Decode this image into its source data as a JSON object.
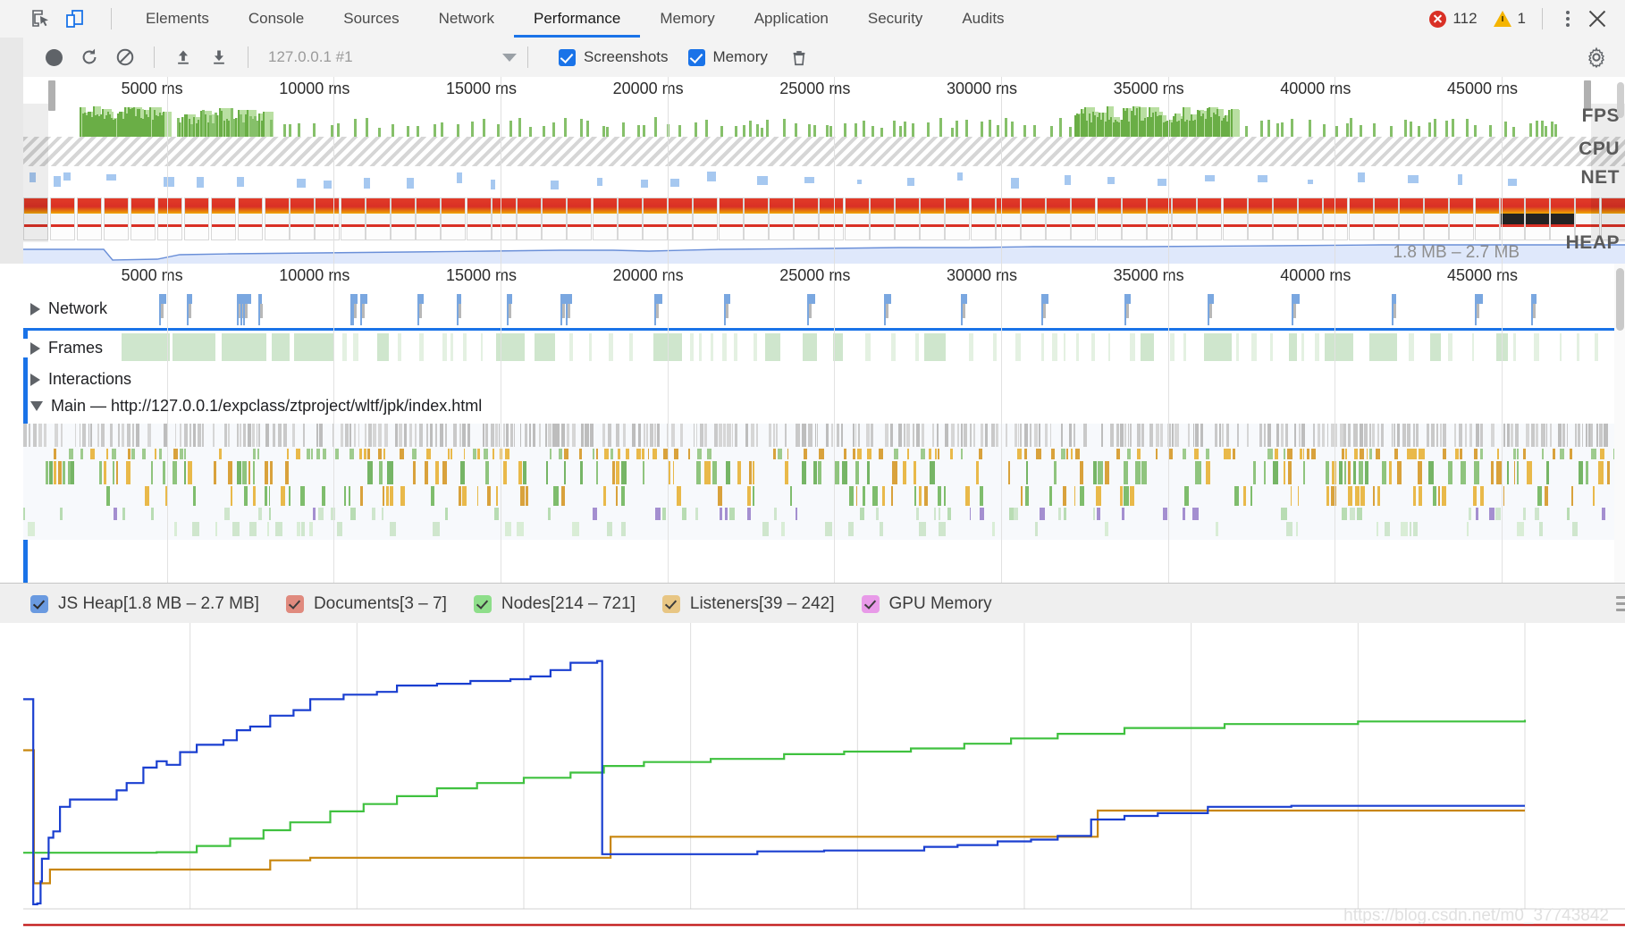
{
  "tabbar": {
    "inspect_icon": "inspect-element-icon",
    "device_icon": "device-toolbar-icon",
    "tabs": [
      {
        "label": "Elements",
        "active": false
      },
      {
        "label": "Console",
        "active": false
      },
      {
        "label": "Sources",
        "active": false
      },
      {
        "label": "Network",
        "active": false
      },
      {
        "label": "Performance",
        "active": true
      },
      {
        "label": "Memory",
        "active": false
      },
      {
        "label": "Application",
        "active": false
      },
      {
        "label": "Security",
        "active": false
      },
      {
        "label": "Audits",
        "active": false
      }
    ],
    "error_count": "112",
    "warning_count": "1",
    "more_icon": "kebab-menu-icon",
    "close_icon": "close-icon"
  },
  "toolbar": {
    "record_icon": "record-button",
    "reload_icon": "reload-and-record-icon",
    "clear_icon": "clear-recording-icon",
    "load_icon": "load-profile-icon",
    "save_icon": "save-profile-icon",
    "session_label": "127.0.0.1 #1",
    "session_caret": "chevron-down-icon",
    "screenshots_label": "Screenshots",
    "screenshots_checked": true,
    "memory_label": "Memory",
    "memory_checked": true,
    "trash_icon": "collect-garbage-icon",
    "settings_icon": "gear-icon"
  },
  "overview": {
    "ticks": [
      "5000 ms",
      "10000 ms",
      "15000 ms",
      "20000 ms",
      "25000 ms",
      "30000 ms",
      "35000 ms",
      "40000 ms",
      "45000 ms"
    ],
    "rows": [
      {
        "label": "FPS"
      },
      {
        "label": "CPU"
      },
      {
        "label": "NET"
      },
      {
        "label": "HEAP"
      }
    ],
    "heap_range": "1.8 MB – 2.7 MB"
  },
  "timeline": {
    "ticks": [
      "5000 ms",
      "10000 ms",
      "15000 ms",
      "20000 ms",
      "25000 ms",
      "30000 ms",
      "35000 ms",
      "40000 ms",
      "45000 ms"
    ],
    "tracks": [
      {
        "label": "Network",
        "expanded": false
      },
      {
        "label": "Frames",
        "expanded": false
      },
      {
        "label": "Interactions",
        "expanded": false
      },
      {
        "label": "Main — http://127.0.0.1/expclass/ztproject/wltf/jpk/index.html",
        "expanded": true
      }
    ]
  },
  "memory_legend": {
    "items": [
      {
        "label": "JS Heap[1.8 MB – 2.7 MB]",
        "color": "#6a9ae0",
        "checked": true
      },
      {
        "label": "Documents[3 – 7]",
        "color": "#e08a7e",
        "checked": true
      },
      {
        "label": "Nodes[214 – 721]",
        "color": "#8ede8a",
        "checked": true
      },
      {
        "label": "Listeners[39 – 242]",
        "color": "#e8c684",
        "checked": true
      },
      {
        "label": "GPU Memory",
        "color": "#e89ae8",
        "checked": true
      }
    ],
    "menu_icon": "hamburger-menu-icon"
  },
  "watermark": "https://blog.csdn.net/m0_37743842",
  "chart_data": {
    "type": "line",
    "title": "Memory counters over time",
    "xlabel": "",
    "ylabel": "",
    "x": [
      0,
      5000,
      10000,
      15000,
      20000,
      25000,
      30000,
      35000,
      40000,
      45000
    ],
    "xlim": [
      0,
      48000
    ],
    "grid": true,
    "legend_position": "top",
    "series": [
      {
        "name": "JS Heap",
        "color": "#1a3fd0",
        "unit": "MB",
        "range": [
          1.8,
          2.7
        ],
        "points": [
          [
            0,
            2.3
          ],
          [
            260,
            2.3
          ],
          [
            300,
            0.05
          ],
          [
            420,
            0.06
          ],
          [
            520,
            0.3
          ],
          [
            560,
            0.55
          ],
          [
            760,
            0.78
          ],
          [
            900,
            0.85
          ],
          [
            1100,
            1.12
          ],
          [
            1400,
            1.2
          ],
          [
            2600,
            1.2
          ],
          [
            2800,
            1.3
          ],
          [
            3100,
            1.38
          ],
          [
            3600,
            1.55
          ],
          [
            4000,
            1.62
          ],
          [
            4300,
            1.58
          ],
          [
            4700,
            1.72
          ],
          [
            5200,
            1.8
          ],
          [
            6000,
            1.85
          ],
          [
            6400,
            1.96
          ],
          [
            6800,
            2.0
          ],
          [
            7400,
            2.12
          ],
          [
            8100,
            2.18
          ],
          [
            8600,
            2.3
          ],
          [
            9600,
            2.35
          ],
          [
            10600,
            2.38
          ],
          [
            11200,
            2.45
          ],
          [
            12400,
            2.47
          ],
          [
            13400,
            2.5
          ],
          [
            14600,
            2.52
          ],
          [
            15200,
            2.55
          ],
          [
            15800,
            2.62
          ],
          [
            16400,
            2.7
          ],
          [
            17200,
            2.72
          ],
          [
            17350,
            0.6
          ],
          [
            20000,
            0.6
          ],
          [
            22000,
            0.63
          ],
          [
            24000,
            0.64
          ],
          [
            27000,
            0.68
          ],
          [
            28000,
            0.7
          ],
          [
            29200,
            0.74
          ],
          [
            30200,
            0.76
          ],
          [
            31000,
            0.8
          ],
          [
            32000,
            0.98
          ],
          [
            33000,
            1.02
          ],
          [
            34000,
            1.05
          ],
          [
            35500,
            1.12
          ],
          [
            38000,
            1.13
          ],
          [
            45000,
            1.13
          ]
        ]
      },
      {
        "name": "Nodes",
        "color": "#3fc13f",
        "unit": "count",
        "range": [
          214,
          721
        ],
        "points": [
          [
            0,
            214
          ],
          [
            300,
            214
          ],
          [
            4000,
            216
          ],
          [
            5200,
            240
          ],
          [
            6200,
            268
          ],
          [
            7200,
            300
          ],
          [
            8000,
            330
          ],
          [
            9200,
            372
          ],
          [
            10200,
            400
          ],
          [
            11200,
            430
          ],
          [
            12400,
            460
          ],
          [
            13600,
            480
          ],
          [
            15000,
            500
          ],
          [
            16400,
            520
          ],
          [
            17400,
            545
          ],
          [
            18600,
            560
          ],
          [
            20600,
            572
          ],
          [
            22800,
            590
          ],
          [
            24600,
            600
          ],
          [
            26600,
            612
          ],
          [
            28200,
            630
          ],
          [
            29600,
            650
          ],
          [
            31000,
            668
          ],
          [
            33000,
            690
          ],
          [
            36000,
            705
          ],
          [
            40000,
            715
          ],
          [
            45000,
            721
          ]
        ]
      },
      {
        "name": "Listeners",
        "color": "#c8860d",
        "unit": "count",
        "range": [
          39,
          242
        ],
        "points": [
          [
            0,
            242
          ],
          [
            300,
            242
          ],
          [
            320,
            39
          ],
          [
            800,
            60
          ],
          [
            6400,
            60
          ],
          [
            7400,
            74
          ],
          [
            8600,
            78
          ],
          [
            17000,
            78
          ],
          [
            17600,
            110
          ],
          [
            31800,
            110
          ],
          [
            32200,
            150
          ],
          [
            45000,
            150
          ]
        ]
      },
      {
        "name": "Documents",
        "color": "#c62828",
        "unit": "count",
        "range": [
          3,
          7
        ],
        "points": [
          [
            0,
            3
          ],
          [
            45000,
            3
          ]
        ]
      },
      {
        "name": "GPU Memory",
        "color": "#e89ae8",
        "unit": "",
        "range": [
          0,
          0
        ],
        "points": []
      }
    ]
  }
}
